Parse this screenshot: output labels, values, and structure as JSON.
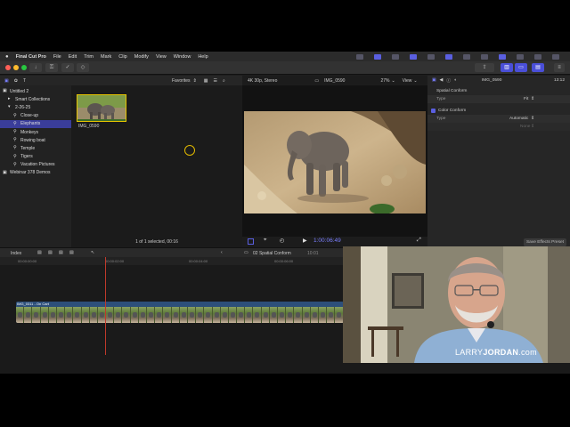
{
  "menubar": {
    "apple": "",
    "items": [
      "Final Cut Pro",
      "File",
      "Edit",
      "Trim",
      "Mark",
      "Clip",
      "Modify",
      "View",
      "Window",
      "Help"
    ]
  },
  "toolbar": {
    "buttons": [
      "import",
      "keywords",
      "background-tasks",
      "share"
    ]
  },
  "sidebar": {
    "items": [
      {
        "label": "Untitled 2",
        "indent": 0,
        "icon": "library-icon"
      },
      {
        "label": "Smart Collections",
        "indent": 1,
        "icon": "folder-icon"
      },
      {
        "label": "2-26-25",
        "indent": 1,
        "icon": "event-icon"
      },
      {
        "label": "Close-up",
        "indent": 2,
        "icon": "keyword-icon"
      },
      {
        "label": "Elephants",
        "indent": 2,
        "icon": "keyword-icon",
        "selected": true
      },
      {
        "label": "Monkeys",
        "indent": 2,
        "icon": "keyword-icon"
      },
      {
        "label": "Rowing boat",
        "indent": 2,
        "icon": "keyword-icon"
      },
      {
        "label": "Temple",
        "indent": 2,
        "icon": "keyword-icon"
      },
      {
        "label": "Tigers",
        "indent": 2,
        "icon": "keyword-icon"
      },
      {
        "label": "Vacation Pictures",
        "indent": 2,
        "icon": "keyword-icon"
      },
      {
        "label": "Webinar 378 Demos",
        "indent": 0,
        "icon": "library-icon"
      }
    ]
  },
  "browser": {
    "filter": "Favorites",
    "clip_name": "IMG_0590",
    "footer": "1 of 1 selected, 00:16"
  },
  "viewer": {
    "format": "4K 30p, Stereo",
    "clip_name": "IMG_0590",
    "zoom": "27%",
    "view_label": "View",
    "timecode": "1:00:06:49"
  },
  "inspector": {
    "clip_name": "IMG_0590",
    "duration": "13:12",
    "spatial_conform": "Spatial Conform",
    "type_label": "Type",
    "type_value": "Fit",
    "color_conform": "Color Conform",
    "type_label_2": "Type",
    "type_value_2": "Automatic",
    "type_label_3": "",
    "type_value_3": "None",
    "save_preset": "Save Effects Preset"
  },
  "timeline": {
    "index_label": "Index",
    "project_name": "02 Spatial Conform",
    "project_duration": "10:01",
    "ruler": [
      "00:00:00:00",
      "00:00:02:00",
      "00:00:04:00",
      "00:00:06:00"
    ],
    "clip_label": "IMG_0311 - On Cart",
    "frame_count": 40
  },
  "webcam": {
    "watermark_light": "LARRY",
    "watermark_bold": "JORDAN",
    "watermark_tail": ".com"
  },
  "colors": {
    "accent": "#4a4fd8",
    "selection": "#3a3d9a",
    "clip_border": "#e6c300",
    "playhead": "#c0392b"
  }
}
